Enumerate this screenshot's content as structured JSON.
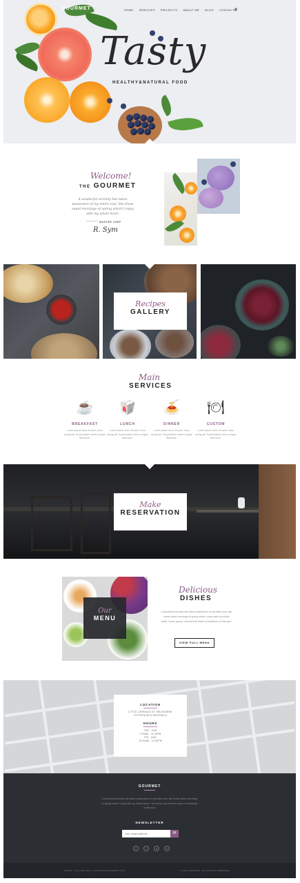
{
  "brand": {
    "logo": "GOURMET"
  },
  "nav": {
    "items": [
      "HOME",
      "SERVICES",
      "PROJECTS",
      "ABOUT ME",
      "BLOG",
      "CONTACTS"
    ],
    "close_icon": "✕"
  },
  "hero": {
    "title": "Tasty",
    "subtitle": "HEALTHY&NATURAL FOOD"
  },
  "welcome": {
    "script": "Welcome!",
    "title_small": "THE",
    "title": "GOURMET",
    "text": "A wonderful serenity has taken possession of my entire soul, like these sweet mornings of spring which I enjoy with my whole heart.",
    "role": "MASTER CHEF",
    "signature": "R. Sym"
  },
  "gallery": {
    "script": "Recipes",
    "title": "GALLERY"
  },
  "services": {
    "script": "Main",
    "title": "SERVICES",
    "items": [
      {
        "label": "BREAKFAST",
        "icon": "coffee-cup-icon",
        "glyph": "☕",
        "text": "Lorem ipsum dolor sit amet, dolor ipsing elit. Suspendisse varius congue bibendum."
      },
      {
        "label": "LUNCH",
        "icon": "takeout-box-icon",
        "glyph": "🥡",
        "text": "Lorem ipsum dolor sit amet, dolor ipsing elit. Suspendisse varius congue bibendum."
      },
      {
        "label": "DINNER",
        "icon": "dinner-plate-icon",
        "glyph": "🍝",
        "text": "Lorem ipsum dolor sit amet, dolor ipsing elit. Suspendisse varius congue bibendum."
      },
      {
        "label": "CUSTOM",
        "icon": "plate-cutlery-icon",
        "glyph": "🍽",
        "text": "Lorem ipsum dolor sit amet, dolor ipsing elit. Suspendisse varius congue bibendum."
      }
    ]
  },
  "reservation": {
    "script": "Make",
    "title": "RESERVATION"
  },
  "menu": {
    "script": "Our",
    "title": "MENU"
  },
  "dishes": {
    "script": "Delicious",
    "title": "DISHES",
    "text": "A wonderful serenity has taken possession of my entire soul, like these sweet mornings of spring which I enjoy with my whole heart. Lorem ipsum, and feel the charm of existence in this spot.",
    "button": "VIEW FULL MENU"
  },
  "info": {
    "location_title": "LOCATION",
    "address": "LITTLE LONSDALE ST, MELBOURNE VICTORIA 8011 AUSTRALIA",
    "hours_title": "HOURS",
    "hours": [
      "TUE - SUN",
      "7:30AM - 11:30PM",
      "FRI - SUN",
      "10:30AM - 12:30PM"
    ]
  },
  "footer": {
    "title": "GOURMET",
    "text": "A wonderful serenity has taken possession of my entire soul, like these sweet mornings of spring which I enjoy with my whole heart. I am alone, and feel the charm of existence in this spot.",
    "newsletter_title": "NEWSLETTER",
    "email_placeholder": "Your email address",
    "submit_glyph": "✉",
    "social": [
      {
        "name": "twitter-icon",
        "glyph": "t"
      },
      {
        "name": "facebook-icon",
        "glyph": "f"
      },
      {
        "name": "google-plus-icon",
        "glyph": "g"
      },
      {
        "name": "instagram-icon",
        "glyph": "◎"
      }
    ],
    "bottom_left": "PHONE: +1(0) 234 5678  •  SUPPORT@GOURMET.COM",
    "bottom_right": "© 2016 GOURMET. ALL RIGHTS RESERVED"
  },
  "colors": {
    "accent": "#8a5a85",
    "footer_bg": "#2b2f33",
    "hero_bg": "#eceef2"
  }
}
